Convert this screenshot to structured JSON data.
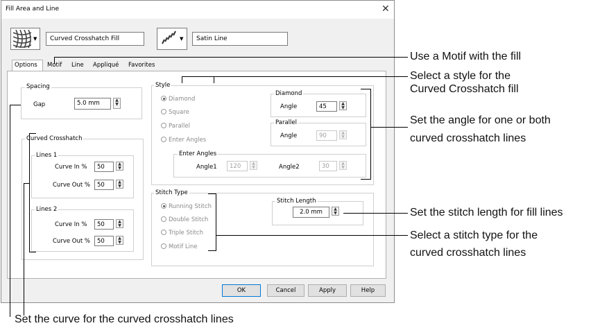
{
  "dialog": {
    "title": "Fill Area and Line",
    "close_glyph": "✕",
    "fill_type_name": "Curved Crosshatch Fill",
    "line_type_name": "Satin Line",
    "fill_icon": "crosshatch-pattern-icon",
    "line_icon": "satin-line-icon"
  },
  "tabs": [
    "Options",
    "Motif",
    "Line",
    "Appliqué",
    "Favorites"
  ],
  "spacing": {
    "title": "Spacing",
    "gap_label": "Gap",
    "gap_value": "5.0 mm"
  },
  "curved_crosshatch": {
    "title": "Curved Crosshatch",
    "lines1": {
      "title": "Lines 1",
      "curve_in_label": "Curve In %",
      "curve_in": "50",
      "curve_out_label": "Curve Out %",
      "curve_out": "50"
    },
    "lines2": {
      "title": "Lines 2",
      "curve_in_label": "Curve In %",
      "curve_in": "50",
      "curve_out_label": "Curve Out %",
      "curve_out": "50"
    }
  },
  "style": {
    "title": "Style",
    "options": [
      "Diamond",
      "Square",
      "Parallel",
      "Enter Angles"
    ],
    "selected": "Diamond",
    "diamond": {
      "title": "Diamond",
      "angle_label": "Angle",
      "angle": "45"
    },
    "parallel": {
      "title": "Parallel",
      "angle_label": "Angle",
      "angle": "90"
    },
    "enter_angles": {
      "title": "Enter Angles",
      "angle1_label": "Angle1",
      "angle1": "120",
      "angle2_label": "Angle2",
      "angle2": "30"
    }
  },
  "stitch_type": {
    "title": "Stitch Type",
    "options": [
      "Running Stitch",
      "Double Stitch",
      "Triple Stitch",
      "Motif Line"
    ],
    "selected": "Running Stitch"
  },
  "stitch_length": {
    "title": "Stitch Length",
    "value": "2.0 mm"
  },
  "buttons": {
    "ok": "OK",
    "cancel": "Cancel",
    "apply": "Apply",
    "help": "Help"
  },
  "annotations": {
    "motif": "Use a Motif with the fill",
    "style_1": "Select a style for the",
    "style_2": "Curved Crosshatch fill",
    "angle_1": "Set the angle for one or both",
    "angle_2": "curved crosshatch lines",
    "stitch_length": "Set the stitch length for fill lines",
    "stitch_type_1": "Select a stitch type for the",
    "stitch_type_2": "curved crosshatch lines",
    "curve": "Set the curve for the curved crosshatch lines"
  }
}
